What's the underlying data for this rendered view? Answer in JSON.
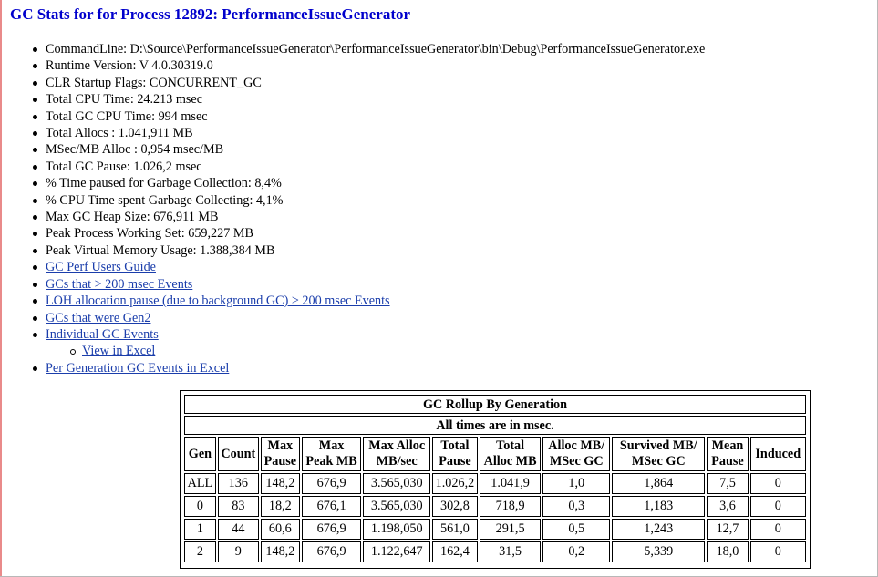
{
  "page": {
    "title": "GC Stats for for Process 12892: PerformanceIssueGenerator"
  },
  "info_items": [
    "CommandLine: D:\\Source\\PerformanceIssueGenerator\\PerformanceIssueGenerator\\bin\\Debug\\PerformanceIssueGenerator.exe",
    "Runtime Version: V 4.0.30319.0",
    "CLR Startup Flags: CONCURRENT_GC",
    "Total CPU Time: 24.213 msec",
    "Total GC CPU Time: 994 msec",
    "Total Allocs : 1.041,911 MB",
    "MSec/MB Alloc : 0,954 msec/MB",
    "Total GC Pause: 1.026,2 msec",
    "% Time paused for Garbage Collection: 8,4%",
    "% CPU Time spent Garbage Collecting: 4,1%",
    "Max GC Heap Size: 676,911 MB",
    "Peak Process Working Set: 659,227 MB",
    "Peak Virtual Memory Usage: 1.388,384 MB"
  ],
  "links": {
    "perf_guide": "GC Perf Users Guide",
    "gcs_over_200": "GCs that > 200 msec Events",
    "loh_pause": "LOH allocation pause (due to background GC) > 200 msec Events",
    "gen2": "GCs that were Gen2",
    "individual": "Individual GC Events",
    "view_excel": "View in Excel",
    "per_generation": "Per Generation GC Events in Excel"
  },
  "rollup": {
    "title": "GC Rollup By Generation",
    "subtitle": "All times are in msec.",
    "headers": {
      "gen": "Gen",
      "count": "Count",
      "max_pause_1": "Max",
      "max_pause_2": "Pause",
      "max_peak_1": "Max",
      "max_peak_2": "Peak MB",
      "max_alloc_1": "Max Alloc",
      "max_alloc_2": "MB/sec",
      "total_pause_1": "Total",
      "total_pause_2": "Pause",
      "total_alloc_1": "Total",
      "total_alloc_2": "Alloc MB",
      "alloc_ratio_1": "Alloc MB/",
      "alloc_ratio_2": "MSec GC",
      "survived_1": "Survived MB/",
      "survived_2": "MSec GC",
      "mean_1": "Mean",
      "mean_2": "Pause",
      "induced": "Induced"
    },
    "rows": [
      [
        "ALL",
        "136",
        "148,2",
        "676,9",
        "3.565,030",
        "1.026,2",
        "1.041,9",
        "1,0",
        "1,864",
        "7,5",
        "0"
      ],
      [
        "0",
        "83",
        "18,2",
        "676,1",
        "3.565,030",
        "302,8",
        "718,9",
        "0,3",
        "1,183",
        "3,6",
        "0"
      ],
      [
        "1",
        "44",
        "60,6",
        "676,9",
        "1.198,050",
        "561,0",
        "291,5",
        "0,5",
        "1,243",
        "12,7",
        "0"
      ],
      [
        "2",
        "9",
        "148,2",
        "676,9",
        "1.122,647",
        "162,4",
        "31,5",
        "0,2",
        "5,339",
        "18,0",
        "0"
      ]
    ]
  }
}
